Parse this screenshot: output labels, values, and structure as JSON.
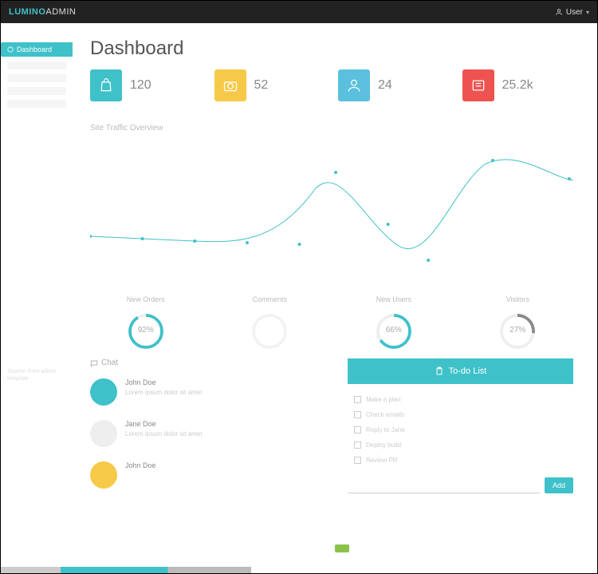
{
  "brand": {
    "a": "LUMINO",
    "b": "ADMIN"
  },
  "user": {
    "label": "User"
  },
  "sidebar": {
    "items": [
      {
        "label": "Dashboard"
      }
    ]
  },
  "page": {
    "title": "Dashboard"
  },
  "stats": [
    {
      "value": "120",
      "color": "#3fc1c9",
      "icon": "bag"
    },
    {
      "value": "52",
      "color": "#f7c948",
      "icon": "camera"
    },
    {
      "value": "24",
      "color": "#5bc0de",
      "icon": "user"
    },
    {
      "value": "25.2k",
      "color": "#ef5350",
      "icon": "newspaper"
    }
  ],
  "traffic": {
    "label": "Site Traffic Overview"
  },
  "chart_data": {
    "type": "line",
    "title": "Site Traffic Overview",
    "x": [
      0,
      1,
      2,
      3,
      4,
      5,
      6,
      7,
      8,
      9
    ],
    "values": [
      27,
      26,
      25,
      24,
      23,
      60,
      32,
      10,
      68,
      58
    ],
    "ylim": [
      0,
      80
    ],
    "xlabel": "",
    "ylabel": ""
  },
  "gauges": [
    {
      "label": "New Orders",
      "pct": 92,
      "text": "92%",
      "color": "#3fc1c9"
    },
    {
      "label": "Comments",
      "pct": 0,
      "text": "",
      "color": "#eee"
    },
    {
      "label": "New Users",
      "pct": 66,
      "text": "66%",
      "color": "#3fc1c9"
    },
    {
      "label": "Visitors",
      "pct": 27,
      "text": "27%",
      "color": "#888"
    }
  ],
  "chat": {
    "header": "Chat",
    "messages": [
      {
        "name": "John Doe",
        "body": "Lorem ipsum dolor sit amet",
        "avatar_color": "cyan",
        "avatar_text": ""
      },
      {
        "name": "Jane Doe",
        "body": "Lorem ipsum dolor sit amet",
        "avatar_color": "",
        "avatar_text": ""
      },
      {
        "name": "John Doe",
        "body": "",
        "avatar_color": "yellow",
        "avatar_text": ""
      }
    ]
  },
  "todo": {
    "header": "To-do List",
    "items": [
      {
        "text": "Make a plan"
      },
      {
        "text": "Check emails"
      },
      {
        "text": "Reply to Jane"
      },
      {
        "text": "Deploy build"
      },
      {
        "text": "Review PR"
      }
    ],
    "add_btn": "Add"
  },
  "footer_note": "Source: Free admin template"
}
